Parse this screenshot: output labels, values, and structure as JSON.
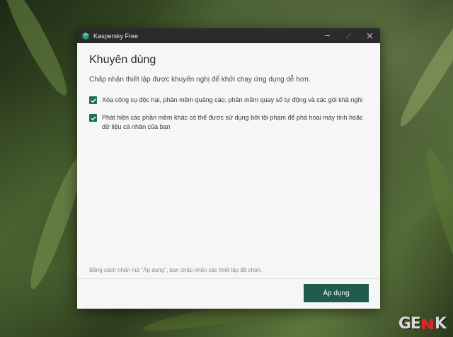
{
  "window": {
    "title": "Kaspersky Free",
    "controls": {
      "minimize": "minimize",
      "maximize": "maximize",
      "close": "close"
    }
  },
  "main": {
    "heading": "Khuyên dùng",
    "subtitle": "Chấp nhận thiết lập được khuyến nghị để khởi chạy ứng dụng dễ hơn.",
    "options": [
      {
        "label": "Xóa công cụ độc hại, phần mềm quảng cáo, phần mềm quay số tự động và các gói khả nghi",
        "checked": true
      },
      {
        "label": "Phát hiện các phần mềm khác có thể được sử dụng bởi tội phạm để phá hoại máy tính hoặc dữ liệu cá nhân của bạn",
        "checked": true
      }
    ],
    "footnote": "Bằng cách nhấn nút \"Áp dụng\", bạn chấp nhận các thiết lập đã chọn."
  },
  "footer": {
    "apply_label": "Áp dụng"
  },
  "watermark": {
    "left": "GE",
    "right": "K"
  },
  "colors": {
    "accent": "#1f5b4f",
    "checkbox": "#1f6f61",
    "titlebar": "#2b2b2b"
  }
}
